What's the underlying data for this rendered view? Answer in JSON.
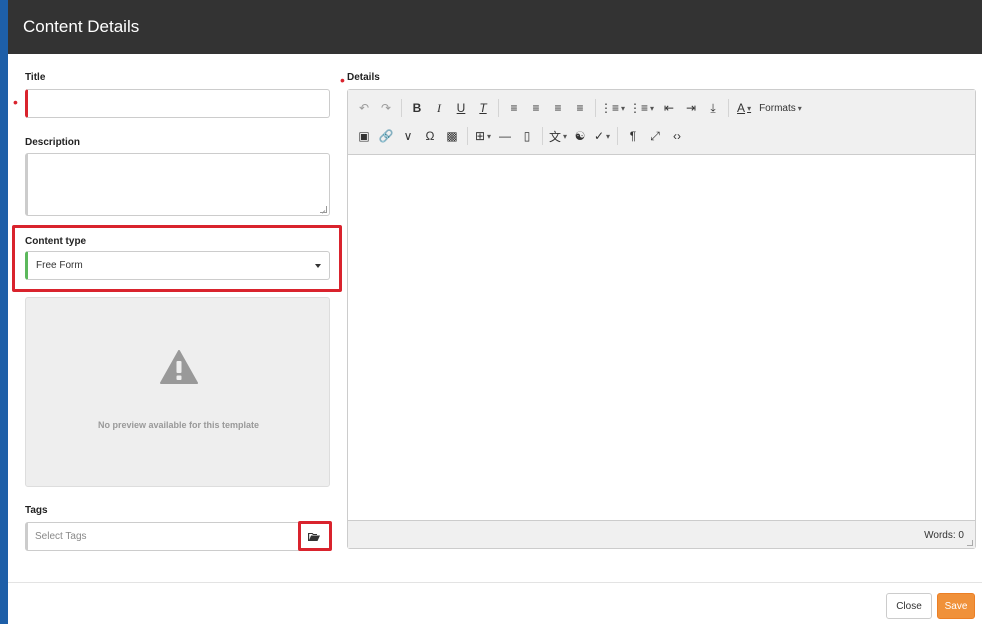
{
  "header": {
    "title": "Content Details"
  },
  "form": {
    "title_label": "Title",
    "title_value": "",
    "description_label": "Description",
    "description_value": "",
    "content_type_label": "Content type",
    "content_type_value": "Free Form",
    "preview_text": "No preview available for this template",
    "tags_label": "Tags",
    "tags_placeholder": "Select Tags"
  },
  "editor": {
    "label": "Details",
    "formats_label": "Formats",
    "word_count": "Words: 0",
    "toolbar_row1": [
      "undo-icon",
      "redo-icon",
      "bold-icon",
      "italic-icon",
      "underline-icon",
      "clear-formatting-icon",
      "align-left-icon",
      "align-center-icon",
      "align-right-icon",
      "align-justify-icon",
      "bullet-list-icon",
      "numbered-list-icon",
      "outdent-icon",
      "indent-icon",
      "insert-icon",
      "text-color-icon"
    ],
    "toolbar_row2": [
      "image-icon",
      "link-icon",
      "unlink-icon",
      "special-char-icon",
      "media-icon",
      "table-icon",
      "horizontal-rule-icon",
      "bookmark-icon",
      "translate-icon",
      "find-icon",
      "spellcheck-icon",
      "paragraph-icon",
      "fullscreen-icon",
      "code-icon"
    ]
  },
  "footer": {
    "close_label": "Close",
    "save_label": "Save"
  },
  "colors": {
    "header_bg": "#333333",
    "required": "#d9232d",
    "save": "#f0913a",
    "highlight": "#d9232d"
  }
}
